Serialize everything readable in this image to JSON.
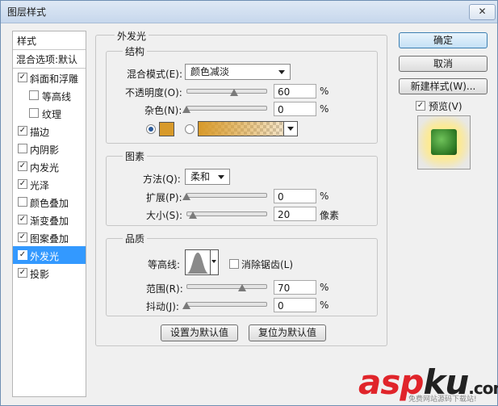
{
  "window": {
    "title": "图层样式",
    "close": "✕"
  },
  "list": {
    "header": "样式",
    "blend_options": "混合选项:默认",
    "items": [
      {
        "label": "斜面和浮雕",
        "checked": true,
        "indent": false
      },
      {
        "label": "等高线",
        "checked": false,
        "indent": true
      },
      {
        "label": "纹理",
        "checked": false,
        "indent": true
      },
      {
        "label": "描边",
        "checked": true,
        "indent": false
      },
      {
        "label": "内阴影",
        "checked": false,
        "indent": false
      },
      {
        "label": "内发光",
        "checked": true,
        "indent": false
      },
      {
        "label": "光泽",
        "checked": true,
        "indent": false
      },
      {
        "label": "颜色叠加",
        "checked": false,
        "indent": false
      },
      {
        "label": "渐变叠加",
        "checked": true,
        "indent": false
      },
      {
        "label": "图案叠加",
        "checked": true,
        "indent": false
      },
      {
        "label": "外发光",
        "checked": true,
        "indent": false,
        "selected": true
      },
      {
        "label": "投影",
        "checked": true,
        "indent": false
      }
    ]
  },
  "panel": {
    "title": "外发光",
    "structure": {
      "title": "结构",
      "blend_mode_label": "混合模式(E):",
      "blend_mode_value": "颜色减淡",
      "opacity_label": "不透明度(O):",
      "opacity_value": "60",
      "opacity_unit": "%",
      "noise_label": "杂色(N):",
      "noise_value": "0",
      "noise_unit": "%",
      "glow_color": "#d89a2a",
      "opacity_fraction": 0.6,
      "noise_fraction": 0
    },
    "elements": {
      "title": "图素",
      "method_label": "方法(Q):",
      "method_value": "柔和",
      "spread_label": "扩展(P):",
      "spread_value": "0",
      "spread_unit": "%",
      "size_label": "大小(S):",
      "size_value": "20",
      "size_unit": "像素",
      "spread_fraction": 0,
      "size_fraction": 0.08
    },
    "quality": {
      "title": "品质",
      "contour_label": "等高线:",
      "antialias_label": "消除锯齿(L)",
      "range_label": "范围(R):",
      "range_value": "70",
      "range_unit": "%",
      "jitter_label": "抖动(J):",
      "jitter_value": "0",
      "jitter_unit": "%",
      "range_fraction": 0.7,
      "jitter_fraction": 0
    },
    "make_default": "设置为默认值",
    "reset_default": "复位为默认值"
  },
  "buttons": {
    "ok": "确定",
    "cancel": "取消",
    "new_style": "新建样式(W)...",
    "preview": "预览(V)"
  },
  "watermark": {
    "asp": "asp",
    "ku": "ku",
    "dotcom": ".com",
    "sub": "免费网站源码下载站!"
  }
}
